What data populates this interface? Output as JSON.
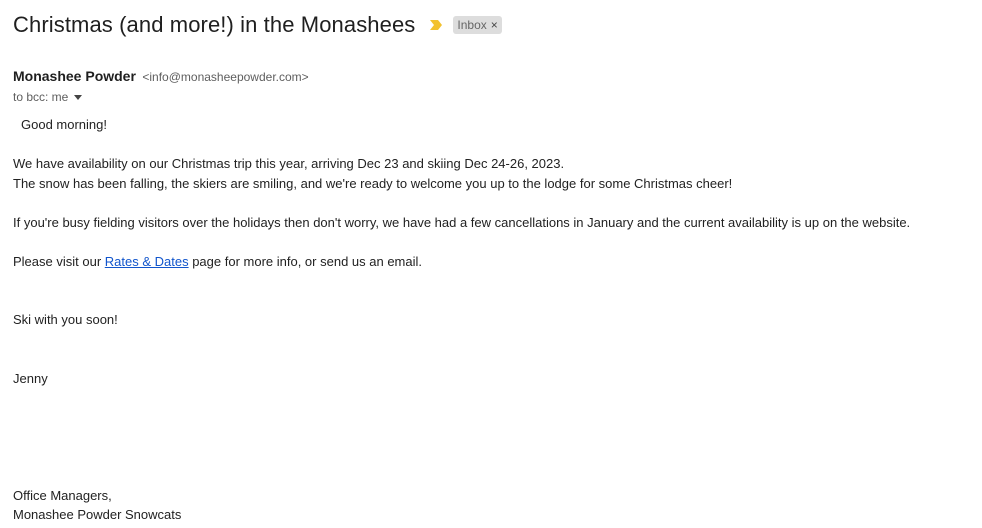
{
  "email": {
    "subject": "Christmas (and more!) in the Monashees",
    "label": "Inbox",
    "label_remove": "×",
    "sender_name": "Monashee Powder",
    "sender_email": "<info@monasheepowder.com>",
    "recipients": "to bcc: me",
    "body": {
      "greeting": "Good morning!",
      "para1_line1": "We have availability on our Christmas trip this year, arriving Dec 23 and skiing Dec 24-26, 2023.",
      "para1_line2": "The snow has been falling, the skiers are smiling, and we're ready to welcome you up to the lodge for some Christmas cheer!",
      "para2": "If you're busy fielding visitors over the holidays then don't worry, we have had a few cancellations in January and the current availability is up on the website.",
      "para3_prefix": "Please visit our ",
      "para3_link": "Rates & Dates",
      "para3_suffix": " page for more info, or send us an email.",
      "closing": "Ski with you soon!",
      "signature_name": "Jenny",
      "signature_title": "Office Managers,",
      "signature_company": "Monashee Powder Snowcats"
    }
  },
  "colors": {
    "importance_marker": "#f2c12e",
    "link": "#1155cc",
    "label_bg": "#dddddd"
  },
  "icons": {
    "importance": "importance-marker-icon",
    "recipients_dropdown": "chevron-down-icon"
  }
}
